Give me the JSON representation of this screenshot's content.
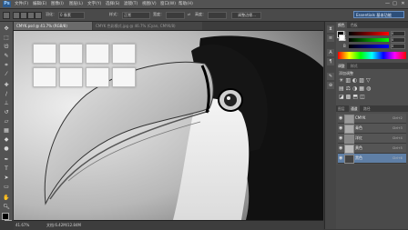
{
  "app": {
    "logo": "Ps"
  },
  "menu": [
    "文件(F)",
    "编辑(E)",
    "图像(I)",
    "图层(L)",
    "文字(Y)",
    "选择(S)",
    "滤镜(T)",
    "视图(V)",
    "窗口(W)",
    "帮助(H)"
  ],
  "window_controls": [
    "—",
    "□",
    "✕"
  ],
  "options": {
    "feather_label": "羽化：",
    "feather_value": "0 像素",
    "style_label": "样式：",
    "style_value": "正常",
    "width_label": "宽度：",
    "height_label": "高度：",
    "refine_button": "调整边缘...",
    "workspace": "Essentials 基本功能"
  },
  "tabs": [
    {
      "label": "CMYK.psd @ 41.7% (RGB/8)",
      "active": true
    },
    {
      "label": "CMYK 色彩模式.jpg @ 46.7% (Cyan, CMYK/8)",
      "active": false
    }
  ],
  "status": {
    "zoom": "41.67%",
    "doc": "文档:6.42M/12.84M"
  },
  "color_panel": {
    "tabs": [
      "颜色",
      "色板"
    ],
    "sliders": [
      {
        "label": "R",
        "value": "0"
      },
      {
        "label": "G",
        "value": "0"
      },
      {
        "label": "B",
        "value": "0"
      }
    ]
  },
  "adjust_panel": {
    "tabs": [
      "调整",
      "样式"
    ],
    "title": "添加调整"
  },
  "layers_panel": {
    "tabs": [
      "图层",
      "通道",
      "路径"
    ],
    "layers": [
      {
        "name": "CMYK",
        "shortcut": "Ctrl+2",
        "selected": false
      },
      {
        "name": "青色",
        "shortcut": "Ctrl+3",
        "selected": false
      },
      {
        "name": "洋红",
        "shortcut": "Ctrl+4",
        "selected": false
      },
      {
        "name": "黄色",
        "shortcut": "Ctrl+5",
        "selected": false
      },
      {
        "name": "黑色",
        "shortcut": "Ctrl+6",
        "selected": true
      }
    ]
  },
  "colors": {
    "accent": "#2d4f7a",
    "selected_layer": "#5f7fa6"
  }
}
